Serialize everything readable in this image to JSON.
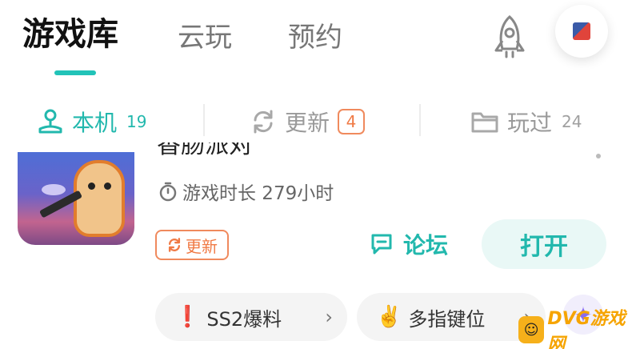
{
  "header": {
    "tabs": [
      {
        "label": "游戏库"
      },
      {
        "label": "云玩"
      },
      {
        "label": "预约"
      }
    ]
  },
  "filters": {
    "local": {
      "label": "本机",
      "count": "19"
    },
    "updates": {
      "label": "更新",
      "count": "4"
    },
    "played": {
      "label": "玩过",
      "count": "24"
    }
  },
  "game": {
    "title": "香肠派对",
    "play_time": "游戏时长 279小时",
    "update_tag": "更新",
    "forum_label": "论坛",
    "open_label": "打开"
  },
  "chips": [
    {
      "emoji": "❗",
      "label": "SS2爆料",
      "chevron": "›"
    },
    {
      "emoji": "✌️",
      "label": "多指键位",
      "chevron": "›"
    }
  ],
  "sparkle": "✦",
  "watermark": {
    "logo": "☺",
    "text": "DVG游戏网"
  },
  "colors": {
    "accent": "#22c3b8",
    "update": "#f07a45"
  }
}
